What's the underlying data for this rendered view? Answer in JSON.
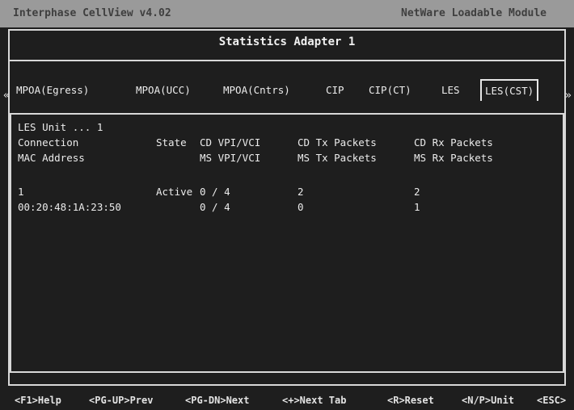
{
  "window": {
    "app_title": "Interphase CellView  v4.02",
    "module_label": "NetWare Loadable Module"
  },
  "screen_title": "Statistics Adapter 1",
  "tabs": [
    {
      "label": "MPOA(Egress)"
    },
    {
      "label": "MPOA(UCC)"
    },
    {
      "label": "MPOA(Cntrs)"
    },
    {
      "label": "CIP"
    },
    {
      "label": "CIP(CT)"
    },
    {
      "label": "LES"
    },
    {
      "label": "LES(CST)",
      "active": true
    }
  ],
  "tab_scroll": {
    "left": "«",
    "right": "»"
  },
  "table": {
    "header": {
      "unit_label": "LES Unit ... 1",
      "col1_line1": "Connection",
      "col1_line2": "MAC Address",
      "state": "State",
      "vpi_line1": "CD VPI/VCI",
      "vpi_line2": "MS VPI/VCI",
      "tx_line1": "CD Tx Packets",
      "tx_line2": "MS Tx Packets",
      "rx_line1": "CD Rx Packets",
      "rx_line2": "MS Rx Packets"
    },
    "rows": [
      {
        "connection": "1",
        "state": "Active",
        "vpi_vci": "0 / 4",
        "tx_packets": "2",
        "rx_packets": "2"
      },
      {
        "connection": "00:20:48:1A:23:50",
        "state": "",
        "vpi_vci": "0 / 4",
        "tx_packets": "0",
        "rx_packets": "1"
      }
    ]
  },
  "footer": [
    {
      "key": "<F1>Help"
    },
    {
      "key": "<PG-UP>Prev"
    },
    {
      "key": "<PG-DN>Next"
    },
    {
      "key": "<+>Next Tab"
    },
    {
      "key": "<R>Reset"
    },
    {
      "key": "<N/P>Unit"
    },
    {
      "key": "<ESC>"
    }
  ]
}
